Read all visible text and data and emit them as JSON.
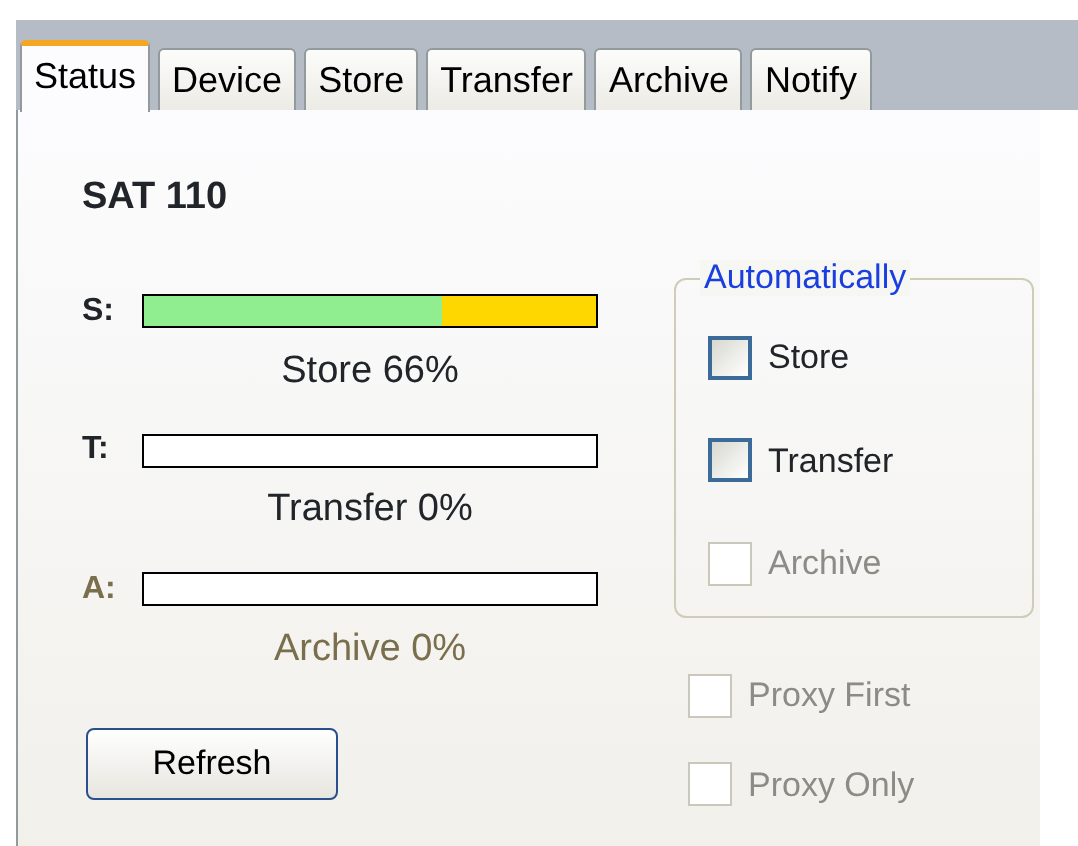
{
  "tabs": [
    {
      "label": "Status",
      "selected": true
    },
    {
      "label": "Device",
      "selected": false
    },
    {
      "label": "Store",
      "selected": false
    },
    {
      "label": "Transfer",
      "selected": false
    },
    {
      "label": "Archive",
      "selected": false
    },
    {
      "label": "Notify",
      "selected": false
    }
  ],
  "device_name": "SAT 110",
  "meters": [
    {
      "letter": "S:",
      "level": 0.66,
      "color": "#ffd700",
      "reading": "Store 66%",
      "disabled": false
    },
    {
      "letter": "T:",
      "level": 0,
      "color": "#ffffff",
      "reading": "Transfer 0%",
      "disabled": false
    },
    {
      "letter": "A:",
      "level": 0,
      "color": "#ffffff",
      "reading": "Archive 0%",
      "disabled": true
    }
  ],
  "refresh_button": "Refresh",
  "group": {
    "title": "Automatically",
    "options": [
      {
        "label": "Store",
        "checked": false,
        "disabled": false
      },
      {
        "label": "Transfer",
        "checked": false,
        "disabled": false
      },
      {
        "label": "Archive",
        "checked": false,
        "disabled": true
      }
    ]
  },
  "options": [
    {
      "label": "Proxy First",
      "checked": false,
      "disabled": true
    },
    {
      "label": "Proxy Only",
      "checked": false,
      "disabled": true
    }
  ]
}
